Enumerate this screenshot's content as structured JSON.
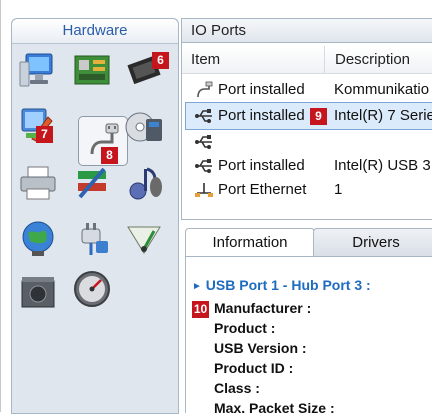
{
  "hardware_panel": {
    "title": "Hardware",
    "icons": [
      "monitor-icon",
      "motherboard-icon",
      "memory-chip-icon",
      "hardware-tool-icon",
      "usb-port-icon",
      "disk-drive-icon",
      "printer-icon",
      "network-cable-icon",
      "audio-icon",
      "internet-globe-icon",
      "power-plug-icon",
      "signal-meter-icon",
      "power-supply-icon",
      "speedometer-icon"
    ],
    "badges": {
      "b6": "6",
      "b7": "7",
      "b8": "8"
    }
  },
  "io_panel": {
    "title": "IO Ports",
    "columns": {
      "item": "Item",
      "description": "Description"
    },
    "rows": [
      {
        "icon": "port-icon",
        "item": "Port installed",
        "description": "Kommunikatio"
      },
      {
        "icon": "usb-icon",
        "item": "Port installed",
        "description": "Intel(R) 7 Serie",
        "selected": true
      },
      {
        "icon": "usb-icon",
        "item": "",
        "description": ""
      },
      {
        "icon": "usb-icon",
        "item": "Port installed",
        "description": "Intel(R) USB 3."
      },
      {
        "icon": "ethernet-icon",
        "item": "Port Ethernet",
        "description": "1"
      }
    ],
    "badge9": "9"
  },
  "tabs": {
    "information": "Information",
    "drivers": "Drivers"
  },
  "info_panel": {
    "header": "USB Port 1 - Hub Port 3 :",
    "badge10": "10",
    "properties": [
      "Manufacturer :",
      "Product :",
      "USB Version :",
      "Product ID :",
      "Class :",
      "Max. Packet Size :"
    ]
  },
  "colors": {
    "accent": "#2c5da8",
    "badge": "#c4161c",
    "selection": "#dcebfb",
    "link": "#1e6bbf"
  }
}
